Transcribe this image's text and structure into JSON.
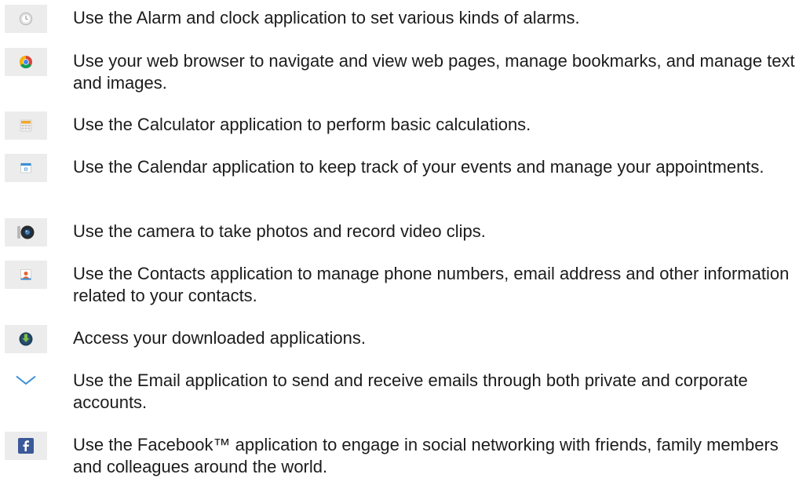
{
  "apps": [
    {
      "icon": "alarm-clock-icon",
      "text": "Use the Alarm and clock application to set various kinds of alarms."
    },
    {
      "icon": "chrome-browser-icon",
      "text": "Use your web browser to navigate and view web pages, manage bookmarks, and manage text and images."
    },
    {
      "icon": "calculator-icon",
      "text": "Use the Calculator application to perform basic calculations."
    },
    {
      "icon": "calendar-icon",
      "text": "Use the Calendar application to keep track of your events and manage your appointments."
    },
    {
      "icon": "camera-icon",
      "text": "Use the camera to take photos and record video clips."
    },
    {
      "icon": "contacts-icon",
      "text": "Use the Contacts application to manage phone numbers, email address and other information related to your contacts."
    },
    {
      "icon": "download-icon",
      "text": "Access your downloaded applications."
    },
    {
      "icon": "email-envelope-icon",
      "text": "Use the Email application to send and receive emails through both private and corporate accounts."
    },
    {
      "icon": "facebook-icon",
      "text": "Use the Facebook™ application to engage in social networking with friends, family members and colleagues around the world."
    }
  ]
}
